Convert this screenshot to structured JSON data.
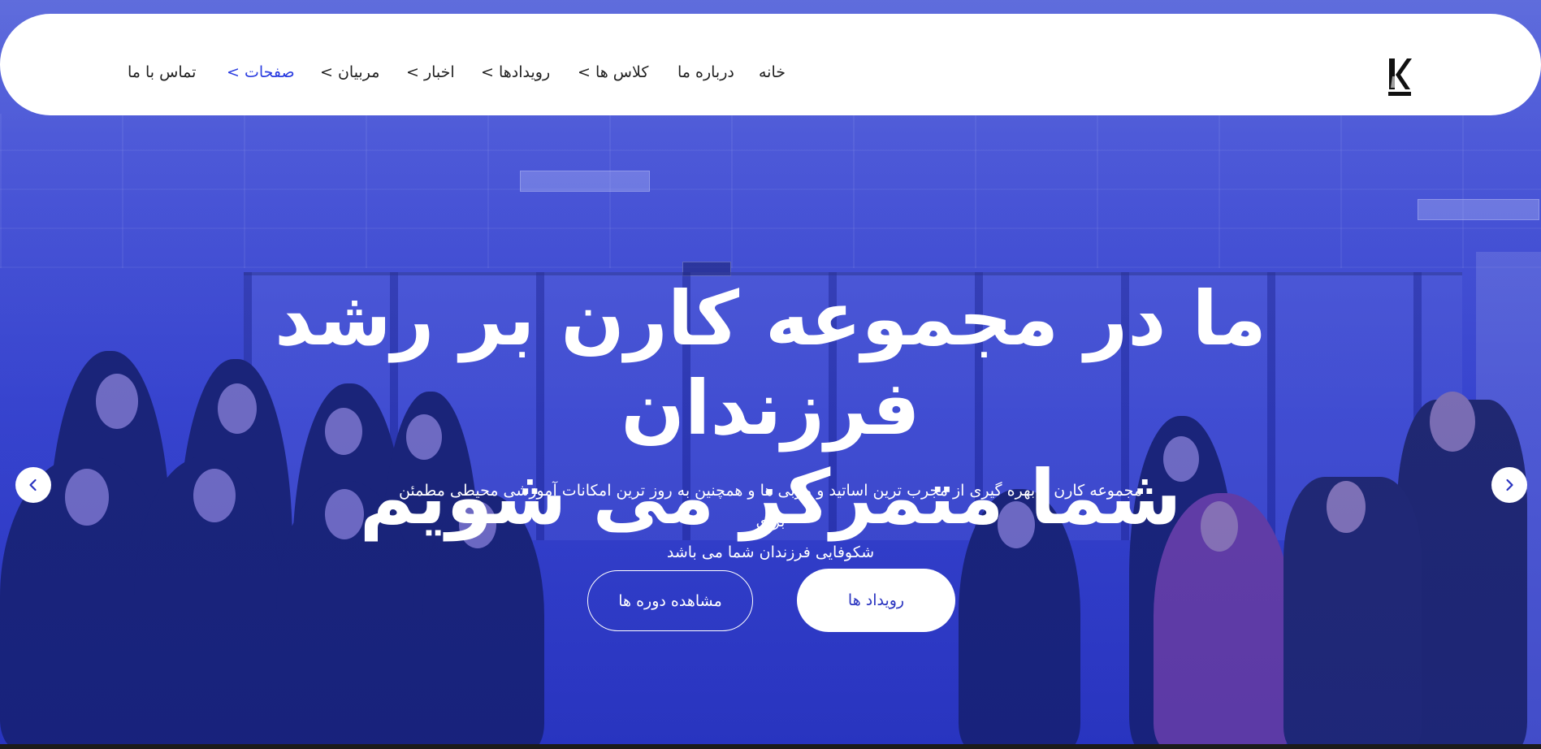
{
  "header": {
    "logo_alt": "Karen",
    "menu": [
      {
        "label": "خانه",
        "has_dropdown": false,
        "active": false
      },
      {
        "label": "درباره ما",
        "has_dropdown": false,
        "active": false
      },
      {
        "label": "کلاس ها >",
        "has_dropdown": true,
        "active": false
      },
      {
        "label": "رویدادها >",
        "has_dropdown": true,
        "active": false
      },
      {
        "label": "اخبار >",
        "has_dropdown": true,
        "active": false
      },
      {
        "label": "مربیان >",
        "has_dropdown": true,
        "active": false
      },
      {
        "label": "صفحات >",
        "has_dropdown": true,
        "active": true
      },
      {
        "label": "تماس با ما",
        "has_dropdown": false,
        "active": false
      }
    ]
  },
  "hero": {
    "headline_line1": "ما در مجموعه کارن بر رشد فرزندان",
    "headline_line2": "شما متمرکز می شویم",
    "subtitle_line1": "مجموعه کارن با بهره گیری از مجرب ترین اساتید و مربی ها و همچنین به روز ترین امکانات آموزشی محیطی مطمئن برای",
    "subtitle_line2": "شکوفایی فرزندان شما می باشد",
    "primary_button": "رویداد ها",
    "secondary_button": "مشاهده دوره ها"
  },
  "colors": {
    "accent": "#2a3ce0",
    "overlay": "#3b47c9",
    "nav_bg": "#ffffff"
  },
  "icons": {
    "prev": "chevron-left-icon",
    "next": "chevron-right-icon"
  }
}
